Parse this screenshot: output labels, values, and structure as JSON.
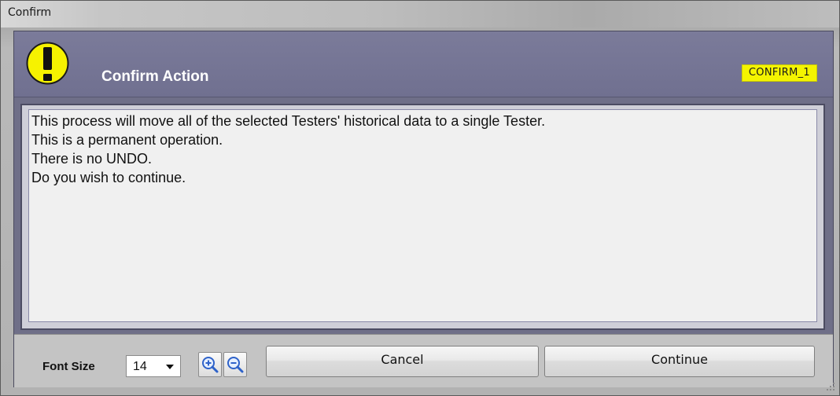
{
  "window": {
    "title": "Confirm"
  },
  "header": {
    "title": "Confirm Action",
    "id_badge": "CONFIRM_1",
    "icon": "exclamation-warning-icon",
    "badge_color": "#f4f400"
  },
  "message": {
    "lines": [
      "This process will move all of the selected Testers' historical data to a single Tester.",
      "This is a permanent operation.",
      "There is no UNDO.",
      "Do you wish to continue."
    ]
  },
  "footer": {
    "font_size_label": "Font Size",
    "font_size_value": "14",
    "zoom_in_icon": "zoom-in-icon",
    "zoom_out_icon": "zoom-out-icon",
    "cancel_label": "Cancel",
    "continue_label": "Continue"
  },
  "colors": {
    "header_bg": "#7474946",
    "accent_blue": "#3a6fd8"
  }
}
